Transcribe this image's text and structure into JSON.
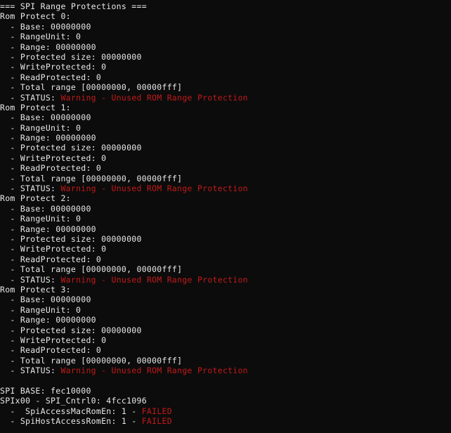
{
  "terminal": {
    "background_color": "#0c0c0c",
    "text_color": "#e8e8e8",
    "warning_color": "#c41919",
    "failed_color": "#c41919",
    "header": "=== SPI Range Protections ===",
    "lines": [
      {
        "segments": [
          {
            "text": "=== SPI Range Protections ===",
            "style": "normal"
          }
        ]
      },
      {
        "segments": [
          {
            "text": "Rom Protect 0:",
            "style": "normal"
          }
        ]
      },
      {
        "segments": [
          {
            "text": "  - Base: 00000000",
            "style": "normal"
          }
        ]
      },
      {
        "segments": [
          {
            "text": "  - RangeUnit: 0",
            "style": "normal"
          }
        ]
      },
      {
        "segments": [
          {
            "text": "  - Range: 00000000",
            "style": "normal"
          }
        ]
      },
      {
        "segments": [
          {
            "text": "  - Protected size: 00000000",
            "style": "normal"
          }
        ]
      },
      {
        "segments": [
          {
            "text": "  - WriteProtected: 0",
            "style": "normal"
          }
        ]
      },
      {
        "segments": [
          {
            "text": "  - ReadProtected: 0",
            "style": "normal"
          }
        ]
      },
      {
        "segments": [
          {
            "text": "  - Total range [00000000, 00000fff]",
            "style": "normal"
          }
        ]
      },
      {
        "segments": [
          {
            "text": "  - STATUS: ",
            "style": "normal"
          },
          {
            "text": "Warning - Unused ROM Range Protection",
            "style": "warn"
          }
        ]
      },
      {
        "segments": [
          {
            "text": "Rom Protect 1:",
            "style": "normal"
          }
        ]
      },
      {
        "segments": [
          {
            "text": "  - Base: 00000000",
            "style": "normal"
          }
        ]
      },
      {
        "segments": [
          {
            "text": "  - RangeUnit: 0",
            "style": "normal"
          }
        ]
      },
      {
        "segments": [
          {
            "text": "  - Range: 00000000",
            "style": "normal"
          }
        ]
      },
      {
        "segments": [
          {
            "text": "  - Protected size: 00000000",
            "style": "normal"
          }
        ]
      },
      {
        "segments": [
          {
            "text": "  - WriteProtected: 0",
            "style": "normal"
          }
        ]
      },
      {
        "segments": [
          {
            "text": "  - ReadProtected: 0",
            "style": "normal"
          }
        ]
      },
      {
        "segments": [
          {
            "text": "  - Total range [00000000, 00000fff]",
            "style": "normal"
          }
        ]
      },
      {
        "segments": [
          {
            "text": "  - STATUS: ",
            "style": "normal"
          },
          {
            "text": "Warning - Unused ROM Range Protection",
            "style": "warn"
          }
        ]
      },
      {
        "segments": [
          {
            "text": "Rom Protect 2:",
            "style": "normal"
          }
        ]
      },
      {
        "segments": [
          {
            "text": "  - Base: 00000000",
            "style": "normal"
          }
        ]
      },
      {
        "segments": [
          {
            "text": "  - RangeUnit: 0",
            "style": "normal"
          }
        ]
      },
      {
        "segments": [
          {
            "text": "  - Range: 00000000",
            "style": "normal"
          }
        ]
      },
      {
        "segments": [
          {
            "text": "  - Protected size: 00000000",
            "style": "normal"
          }
        ]
      },
      {
        "segments": [
          {
            "text": "  - WriteProtected: 0",
            "style": "normal"
          }
        ]
      },
      {
        "segments": [
          {
            "text": "  - ReadProtected: 0",
            "style": "normal"
          }
        ]
      },
      {
        "segments": [
          {
            "text": "  - Total range [00000000, 00000fff]",
            "style": "normal"
          }
        ]
      },
      {
        "segments": [
          {
            "text": "  - STATUS: ",
            "style": "normal"
          },
          {
            "text": "Warning - Unused ROM Range Protection",
            "style": "warn"
          }
        ]
      },
      {
        "segments": [
          {
            "text": "Rom Protect 3:",
            "style": "normal"
          }
        ]
      },
      {
        "segments": [
          {
            "text": "  - Base: 00000000",
            "style": "normal"
          }
        ]
      },
      {
        "segments": [
          {
            "text": "  - RangeUnit: 0",
            "style": "normal"
          }
        ]
      },
      {
        "segments": [
          {
            "text": "  - Range: 00000000",
            "style": "normal"
          }
        ]
      },
      {
        "segments": [
          {
            "text": "  - Protected size: 00000000",
            "style": "normal"
          }
        ]
      },
      {
        "segments": [
          {
            "text": "  - WriteProtected: 0",
            "style": "normal"
          }
        ]
      },
      {
        "segments": [
          {
            "text": "  - ReadProtected: 0",
            "style": "normal"
          }
        ]
      },
      {
        "segments": [
          {
            "text": "  - Total range [00000000, 00000fff]",
            "style": "normal"
          }
        ]
      },
      {
        "segments": [
          {
            "text": "  - STATUS: ",
            "style": "normal"
          },
          {
            "text": "Warning - Unused ROM Range Protection",
            "style": "warn"
          }
        ]
      },
      {
        "segments": [
          {
            "text": "",
            "style": "normal"
          }
        ]
      },
      {
        "segments": [
          {
            "text": "SPI BASE: fec10000",
            "style": "normal"
          }
        ]
      },
      {
        "segments": [
          {
            "text": "SPIx00 - SPI_Cntrl0: 4fcc1096",
            "style": "normal"
          }
        ]
      },
      {
        "segments": [
          {
            "text": "  -  SpiAccessMacRomEn: 1 - ",
            "style": "normal"
          },
          {
            "text": "FAILED",
            "style": "fail"
          }
        ]
      },
      {
        "segments": [
          {
            "text": "  - SpiHostAccessRomEn: 1 - ",
            "style": "normal"
          },
          {
            "text": "FAILED",
            "style": "fail"
          }
        ]
      }
    ]
  }
}
